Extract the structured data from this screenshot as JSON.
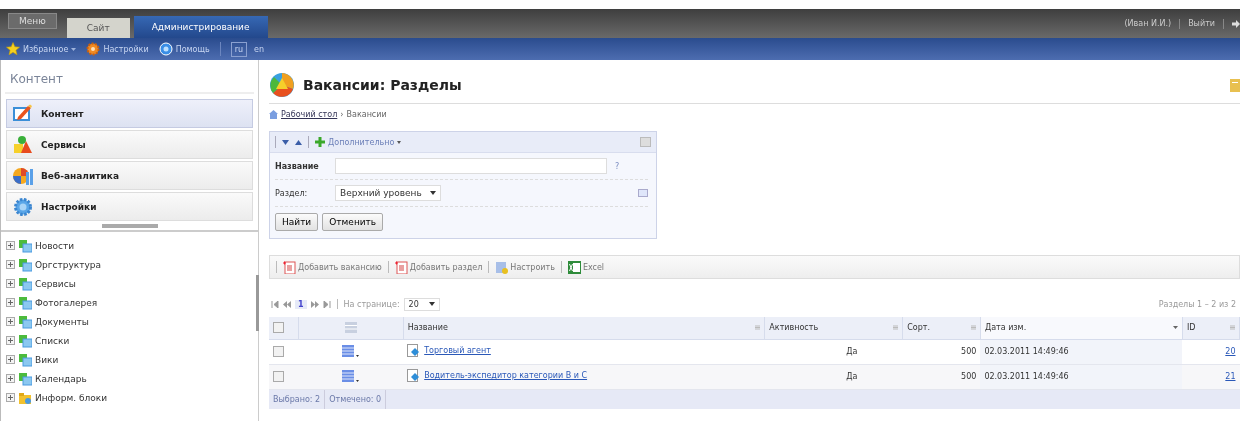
{
  "top_bar": {
    "menu_button": "Меню",
    "tabs": [
      {
        "label": "Сайт",
        "selected": false
      },
      {
        "label": "Администрирование",
        "selected": true
      }
    ],
    "user": "(Иван И.И.)",
    "logout": "Выйти"
  },
  "toolbar": {
    "links": [
      {
        "kind": "favorites",
        "label": "Избранное",
        "dropdown": true
      },
      {
        "kind": "settings",
        "label": "Настройки",
        "dropdown": false
      },
      {
        "kind": "help",
        "label": "Помощь",
        "dropdown": false
      }
    ],
    "languages": [
      {
        "label": "ru",
        "selected": true
      },
      {
        "label": "en",
        "selected": false
      }
    ]
  },
  "sidebar": {
    "title": "Контент",
    "sections": [
      {
        "kind": "content",
        "label": "Контент",
        "selected": true
      },
      {
        "kind": "services",
        "label": "Сервисы",
        "selected": false
      },
      {
        "kind": "analytics",
        "label": "Веб-аналитика",
        "selected": false
      },
      {
        "kind": "settings",
        "label": "Настройки",
        "selected": false
      }
    ],
    "tree": [
      {
        "kind": "section",
        "label": "Новости",
        "expanded": false
      },
      {
        "kind": "section",
        "label": "Оргструктура",
        "expanded": false
      },
      {
        "kind": "section",
        "label": "Сервисы",
        "expanded": false
      },
      {
        "kind": "section",
        "label": "Фотогалерея",
        "expanded": false
      },
      {
        "kind": "section",
        "label": "Документы",
        "expanded": false
      },
      {
        "kind": "section",
        "label": "Списки",
        "expanded": false
      },
      {
        "kind": "section",
        "label": "Вики",
        "expanded": false
      },
      {
        "kind": "section",
        "label": "Календарь",
        "expanded": false
      },
      {
        "kind": "iblock",
        "label": "Информ. блоки",
        "expanded": false
      }
    ]
  },
  "page": {
    "title": "Вакансии: Разделы",
    "breadcrumb": [
      {
        "label": "Рабочий стол",
        "link": true
      },
      {
        "label": "Вакансии",
        "link": false
      }
    ],
    "breadcrumb_separator": "›",
    "filter": {
      "more_label": "Дополнительно",
      "fields": [
        {
          "kind": "text",
          "label": "Название",
          "hint": "?"
        },
        {
          "kind": "select",
          "label": "Раздел:",
          "value": "Верхний уровень"
        }
      ],
      "buttons": [
        "Найти",
        "Отменить"
      ]
    },
    "actions": [
      {
        "kind": "add",
        "label": "Добавить вакансию"
      },
      {
        "kind": "add",
        "label": "Добавить раздел"
      },
      {
        "kind": "configure",
        "label": "Настроить"
      },
      {
        "kind": "excel",
        "label": "Excel"
      }
    ],
    "pager": {
      "current_page": "1",
      "per_page_label": "На странице:",
      "per_page": "20",
      "summary": "Разделы 1 – 2 из 2"
    },
    "table": {
      "all_checked": false,
      "columns": [
        {
          "label": "Название",
          "sorted": false
        },
        {
          "label": "Активность",
          "sorted": false
        },
        {
          "label": "Сорт.",
          "sorted": false
        },
        {
          "label": "Дата изм.",
          "sorted": true
        },
        {
          "label": "ID",
          "sorted": false
        }
      ],
      "rows": [
        {
          "checked": false,
          "name": "Торговый агент",
          "active": "Да",
          "sort": "500",
          "date": "02.03.2011 14:49:46",
          "id": "20"
        },
        {
          "checked": false,
          "name": "Водитель-экспедитор категории В и С",
          "active": "Да",
          "sort": "500",
          "date": "02.03.2011 14:49:46",
          "id": "21"
        }
      ],
      "footer": {
        "selected_label": "Выбрано:",
        "selected": "2",
        "checked_label": "Отмечено:",
        "checked": "0"
      }
    }
  }
}
